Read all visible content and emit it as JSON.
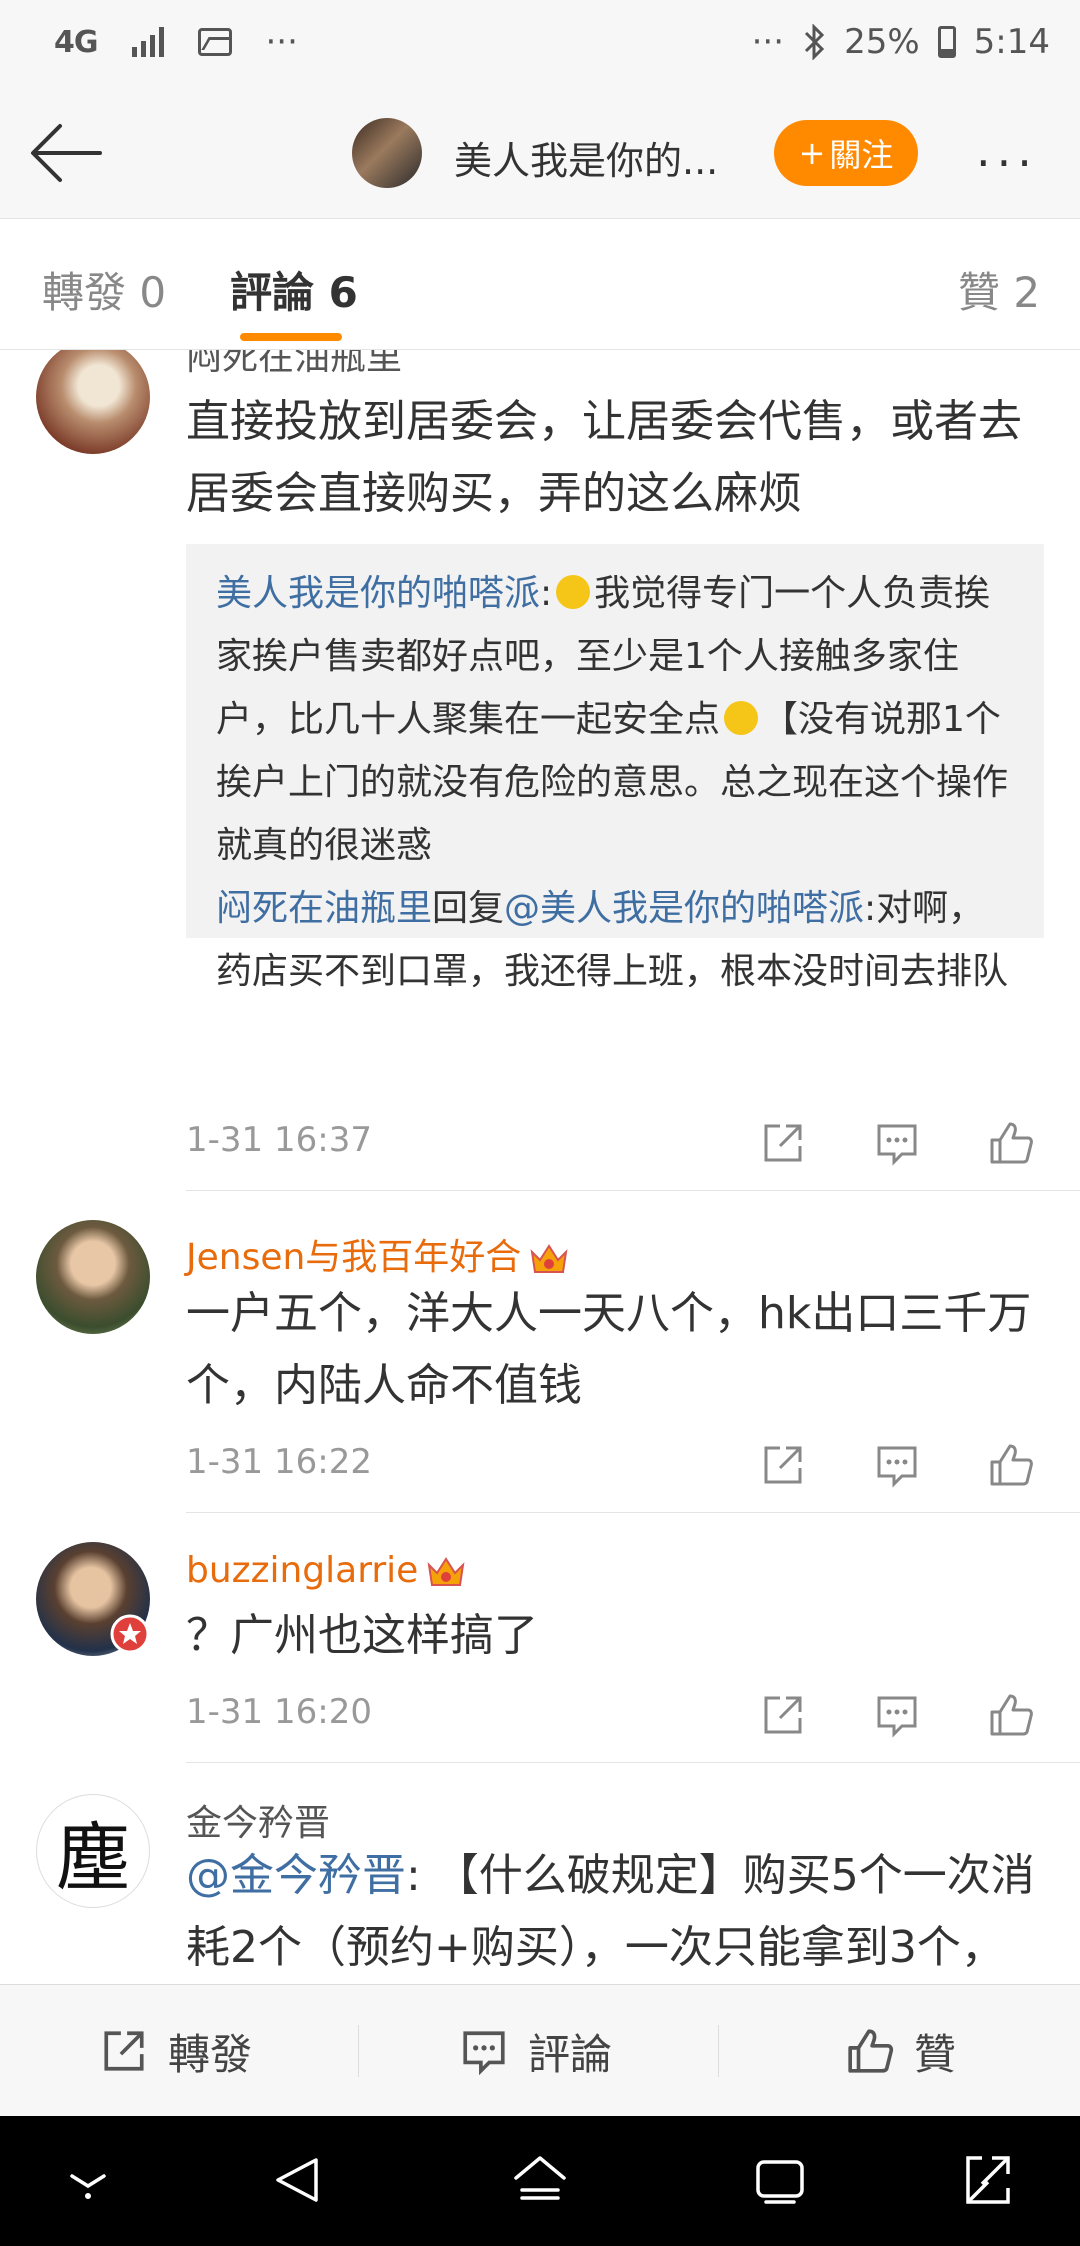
{
  "status_bar": {
    "network": "4G",
    "more_left": "···",
    "more_right": "···",
    "battery": "25%",
    "time": "5:14"
  },
  "nav": {
    "title": "美人我是你的...",
    "follow_label": "關注",
    "follow_plus": "+",
    "more": "···"
  },
  "tabs": [
    {
      "label": "轉發 0"
    },
    {
      "label": "評論 6"
    },
    {
      "label": "贊 2"
    }
  ],
  "comments": [
    {
      "username": "闷死在油瓶里",
      "text": "直接投放到居委会，让居委会代售，或者去居委会直接购买，弄的这么麻烦",
      "quote": {
        "author": "美人我是你的啪嗒派",
        "colon": ":",
        "part1": "我觉得专门一个人负责挨家挨户售卖都好点吧，至少是1个人接触多家住户，比几十人聚集在一起安全点",
        "part2": "【没有说那1个挨户上门的就没有危险的意思。总之现在这个操作就真的很迷惑",
        "reply_user": "闷死在油瓶里",
        "reply_word": "回复",
        "reply_target": "@美人我是你的啪嗒派",
        "reply_text": ":对啊，药店买不到口罩，我还得上班，根本没时间去排队"
      },
      "time": "1-31 16:37"
    },
    {
      "username": "Jensen与我百年好合",
      "text": "一户五个，洋大人一天八个，hk出口三千万个，内陆人命不值钱",
      "time": "1-31 16:22"
    },
    {
      "username": "buzzinglarrie",
      "text": "？广州也这样搞了",
      "time": "1-31 16:20"
    },
    {
      "username": "金今矜晋",
      "avatar_char": "塵",
      "mention": "@金今矜晋",
      "text": ": 【什么破规定】购买5个一次消耗2个（预约+购买），一次只能拿到3个，"
    }
  ],
  "bottom_bar": {
    "repost": "轉發",
    "comment": "評論",
    "like": "贊"
  },
  "colors": {
    "accent": "#ff8a00",
    "username": "#e86b0c",
    "link": "#3f6ea3"
  }
}
